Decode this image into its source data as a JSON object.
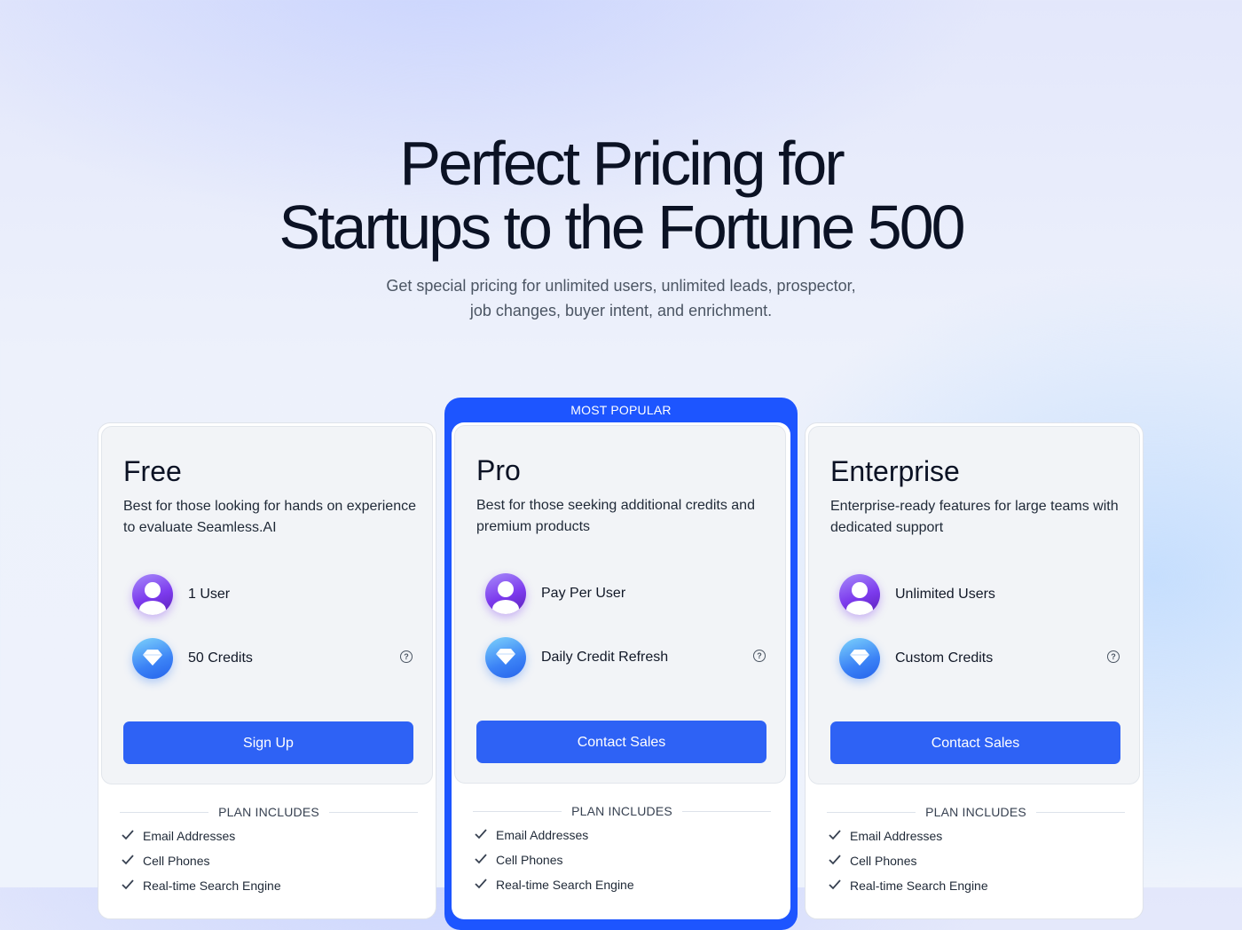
{
  "hero": {
    "title_line1": "Perfect Pricing for",
    "title_line2": "Startups to the Fortune 500",
    "subtitle_line1": "Get special pricing for unlimited users, unlimited leads, prospector,",
    "subtitle_line2": "job changes, buyer intent, and enrichment."
  },
  "popular_badge": "MOST POPULAR",
  "plans": [
    {
      "name": "Free",
      "description": "Best for those looking for hands on experience to evaluate Seamless.AI",
      "users": "1 User",
      "credits": "50 Credits",
      "cta": "Sign Up",
      "includes_label": "PLAN INCLUDES",
      "includes": [
        "Email Addresses",
        "Cell Phones",
        "Real-time Search Engine"
      ]
    },
    {
      "name": "Pro",
      "description": "Best for those seeking additional credits and premium products",
      "users": "Pay Per User",
      "credits": "Daily Credit Refresh",
      "cta": "Contact Sales",
      "includes_label": "PLAN INCLUDES",
      "includes": [
        "Email Addresses",
        "Cell Phones",
        "Real-time Search Engine"
      ]
    },
    {
      "name": "Enterprise",
      "description": "Enterprise-ready features for large teams with dedicated support",
      "users": "Unlimited Users",
      "credits": "Custom Credits",
      "cta": "Contact Sales",
      "includes_label": "PLAN INCLUDES",
      "includes": [
        "Email Addresses",
        "Cell Phones",
        "Real-time Search Engine"
      ]
    }
  ],
  "icons": {
    "users": "user-avatar-icon",
    "credits": "diamond-icon",
    "help": "question-circle-icon",
    "include": "checkmark-icon"
  },
  "colors": {
    "accent": "#2e62f5",
    "popular": "#1d55ff",
    "user_icon": "#7c3aed",
    "credit_icon": "#3b82f6"
  }
}
